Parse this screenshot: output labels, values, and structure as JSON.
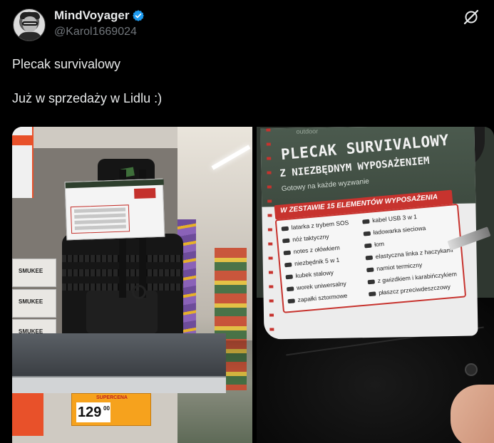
{
  "author": {
    "display_name": "MindVoyager",
    "handle": "@Karol1669024",
    "verified": true
  },
  "tweet": {
    "text": "Plecak survivalowy\n\nJuż w sprzedaży w Lidlu :)"
  },
  "icons": {
    "verified": "verified-badge-icon",
    "grok": "grok-icon"
  },
  "colors": {
    "background": "#000000",
    "text": "#e7e9ea",
    "muted": "#71767b",
    "verified": "#1d9bf0"
  },
  "media": {
    "left_photo": {
      "price_tag": {
        "label": "SUPERCENA",
        "price": "129",
        "cents": "00"
      },
      "shelf_labels": [
        "SMUKEE",
        "SMUKEE",
        "SMUKEE"
      ]
    },
    "right_photo": {
      "brand": "outdoor",
      "title_line1": "PLECAK SURVIVALOWY",
      "title_line2": "Z NIEZBĘDNYM WYPOSAŻENIEM",
      "subtitle": "Gotowy na każde wyzwanie",
      "badge": "W ZESTAWIE 15 ELEMENTÓW WYPOSAŻENIA",
      "items_left": [
        "latarka z trybem SOS",
        "nóż taktyczny",
        "notes z ołówkiem",
        "niezbędnik 5 w 1",
        "kubek stalowy",
        "worek uniwersalny",
        "zapałki sztormowe"
      ],
      "items_right": [
        "kabel USB 3 w 1",
        "ładowarka sieciowa",
        "łom",
        "elastyczna linka z haczykami",
        "namiot termiczny",
        "z gwizdkiem i karabińczykiem",
        "płaszcz przeciwdeszczowy"
      ]
    }
  }
}
